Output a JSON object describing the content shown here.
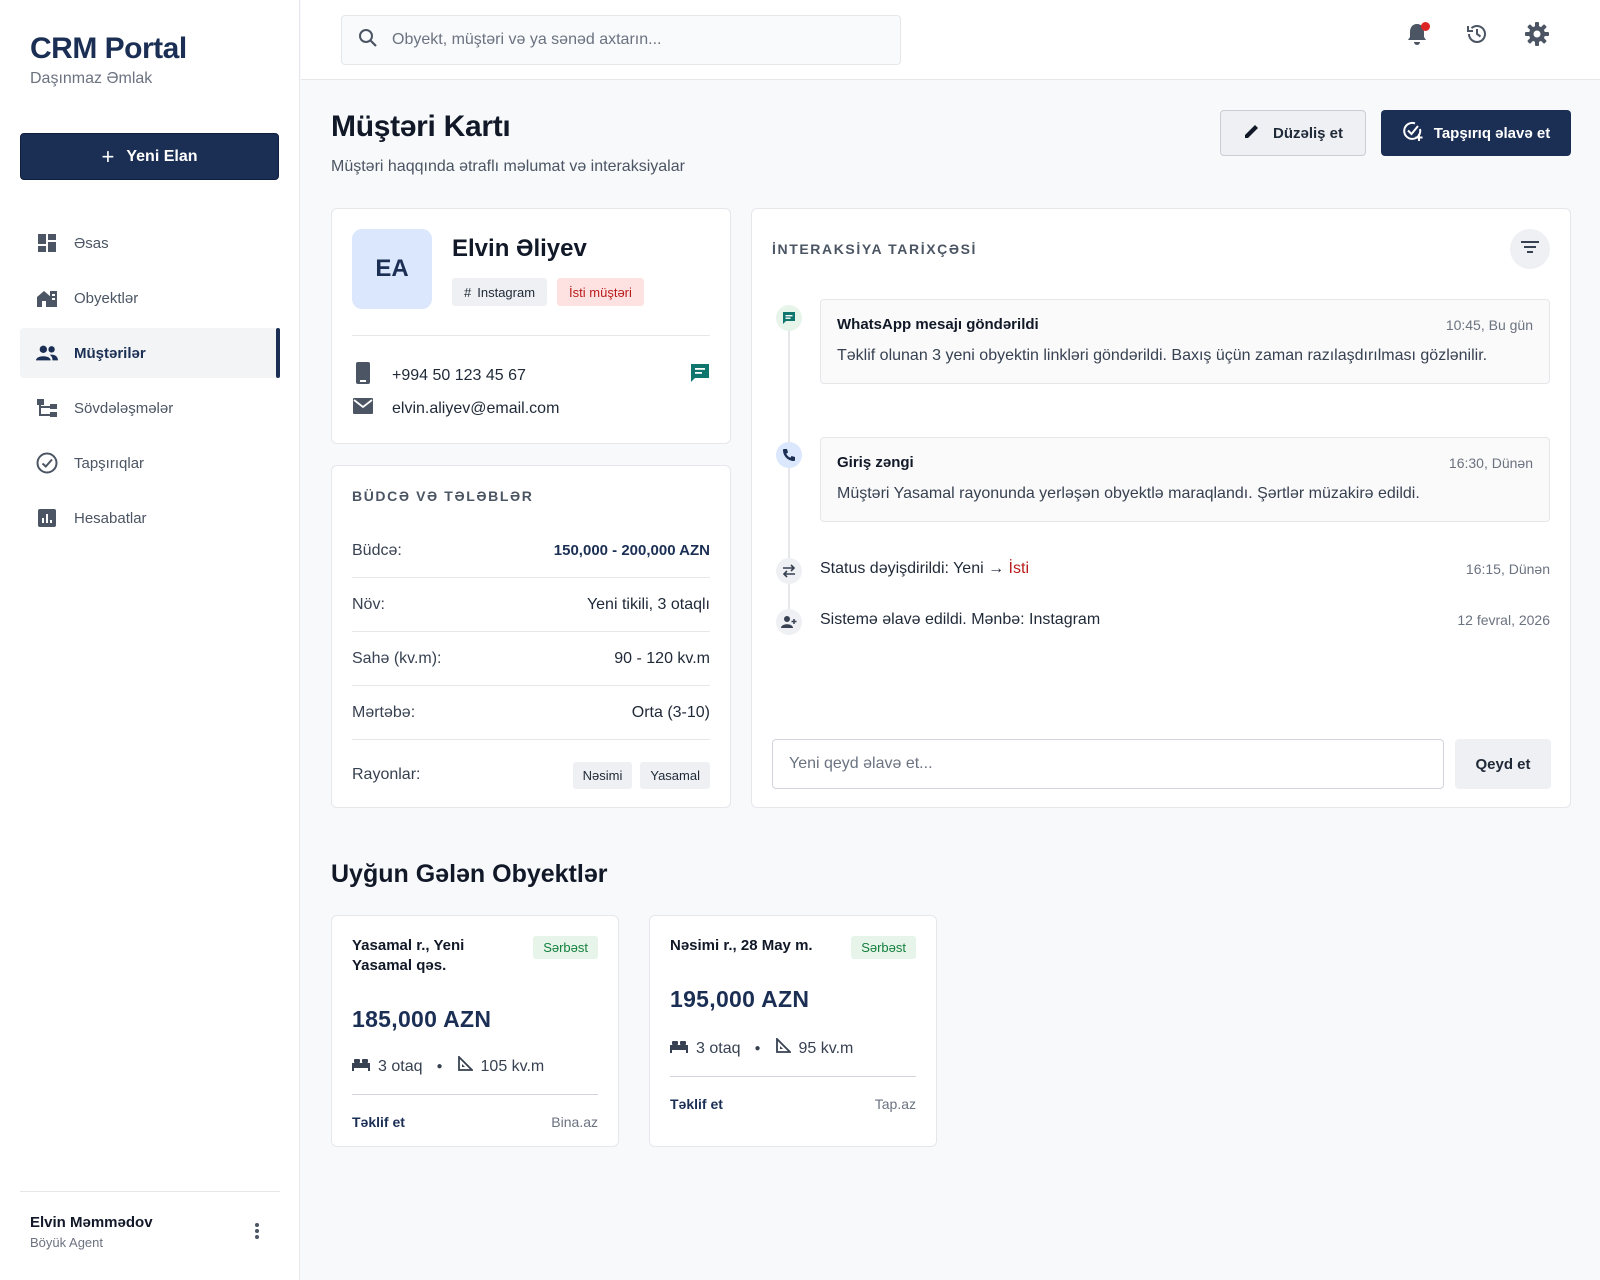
{
  "brand": {
    "title": "CRM Portal",
    "subtitle": "Daşınmaz Əmlak"
  },
  "sidebar": {
    "new_button": "Yeni Elan",
    "items": [
      {
        "label": "Əsas",
        "icon": "dashboard-icon"
      },
      {
        "label": "Obyektlər",
        "icon": "buildings-icon"
      },
      {
        "label": "Müştərilər",
        "icon": "people-icon",
        "active": true
      },
      {
        "label": "Sövdələşmələr",
        "icon": "flow-icon"
      },
      {
        "label": "Tapşırıqlar",
        "icon": "check-circle-icon"
      },
      {
        "label": "Hesabatlar",
        "icon": "report-icon"
      }
    ],
    "user": {
      "name": "Elvin Məmmədov",
      "role": "Böyük Agent"
    }
  },
  "search": {
    "placeholder": "Obyekt, müştəri və ya sənəd axtarın..."
  },
  "page": {
    "title": "Müştəri Kartı",
    "subtitle": "Müştəri haqqında ətraflı məlumat və interaksiyalar",
    "edit_button": "Düzəliş et",
    "task_button": "Tapşırıq əlavə et"
  },
  "profile": {
    "initials": "EA",
    "name": "Elvin Əliyev",
    "source_tag": "Instagram",
    "status_tag": "İsti müştəri",
    "phone": "+994 50 123 45 67",
    "email": "elvin.aliyev@email.com"
  },
  "budget": {
    "title": "BÜDCƏ VƏ TƏLƏBLƏR",
    "rows": [
      {
        "key": "Büdcə:",
        "value": "150,000 - 200,000 AZN"
      },
      {
        "key": "Növ:",
        "value": "Yeni tikili, 3 otaqlı"
      },
      {
        "key": "Sahə (kv.m):",
        "value": "90 - 120 kv.m"
      },
      {
        "key": "Mərtəbə:",
        "value": "Orta (3-10)"
      }
    ],
    "districts_label": "Rayonlar:",
    "districts": [
      "Nəsimi",
      "Yasamal"
    ]
  },
  "history": {
    "title": "İNTERAKSİYA TARİXÇƏSİ",
    "events": [
      {
        "title": "WhatsApp mesajı göndərildi",
        "time": "10:45, Bu gün",
        "body": "Təklif olunan 3 yeni obyektin linkləri göndərildi. Baxış üçün zaman razılaşdırılması gözlənilir."
      },
      {
        "title": "Giriş zəngi",
        "time": "16:30, Dünən",
        "body": "Müştəri Yasamal rayonunda yerləşən obyektlə maraqlandı. Şərtlər müzakirə edildi."
      }
    ],
    "status_change": {
      "prefix": "Status dəyişdirildi: Yeni → ",
      "status": "İsti",
      "time": "16:15, Dünən"
    },
    "added": {
      "text": "Sistemə əlavə edildi. Mənbə: Instagram",
      "time": "12 fevral, 2026"
    },
    "note_placeholder": "Yeni qeyd əlavə et...",
    "note_button": "Qeyd et"
  },
  "matches": {
    "title": "Uyğun Gələn Obyektlər",
    "items": [
      {
        "address": "Yasamal r., Yeni Yasamal qəs.",
        "badge": "Sərbəst",
        "price": "185,000 AZN",
        "rooms": "3 otaq",
        "area": "105 kv.m",
        "action": "Təklif et",
        "source": "Bina.az"
      },
      {
        "address": "Nəsimi r., 28 May m.",
        "badge": "Sərbəst",
        "price": "195,000 AZN",
        "rooms": "3 otaq",
        "area": "95 kv.m",
        "action": "Təklif et",
        "source": "Tap.az"
      }
    ]
  },
  "colors": {
    "primary": "#1b2f55",
    "danger": "#b91c1c",
    "success": "#15803d",
    "whatsapp": "#0f766e"
  }
}
